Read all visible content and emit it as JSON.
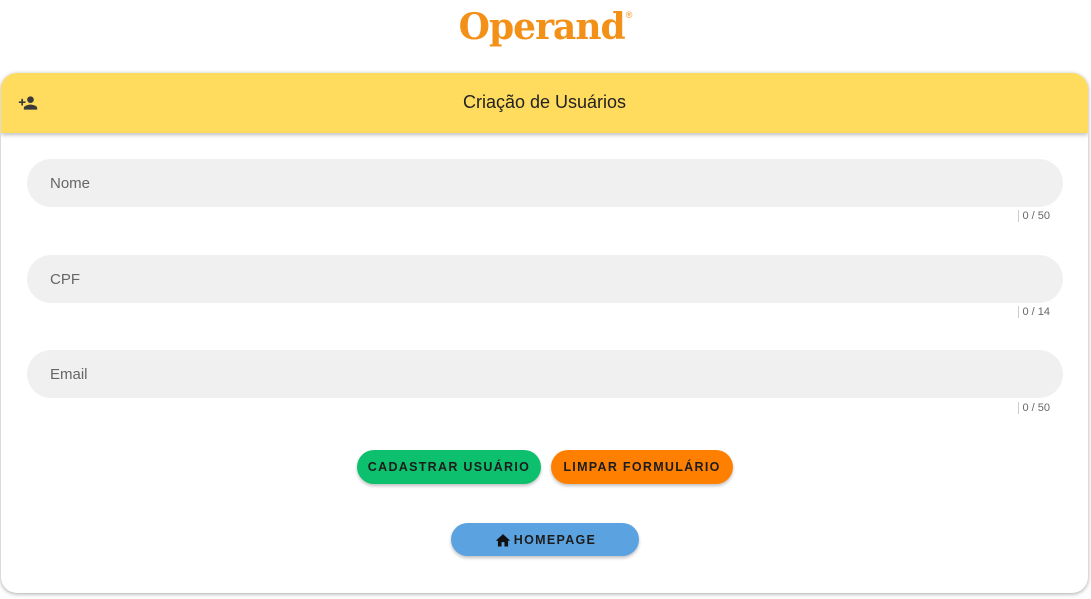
{
  "logo": {
    "text": "Operand",
    "mark": "®"
  },
  "header": {
    "title": "Criação de Usuários",
    "icon": "person-add-icon"
  },
  "form": {
    "nome": {
      "placeholder": "Nome",
      "value": "",
      "counter": "0 / 50"
    },
    "cpf": {
      "placeholder": "CPF",
      "value": "",
      "counter": "0 / 14"
    },
    "email": {
      "placeholder": "Email",
      "value": "",
      "counter": "0 / 50"
    }
  },
  "actions": {
    "register_label": "CADASTRAR USUÁRIO",
    "clear_label": "LIMPAR FORMULÁRIO",
    "home_label": "HOMEPAGE",
    "home_icon": "home-icon"
  },
  "colors": {
    "brand": "#f39018",
    "header_bg": "#ffdb5e",
    "register_bg": "#0cc06e",
    "clear_bg": "#ff8000",
    "home_bg": "#5aa2e0"
  }
}
